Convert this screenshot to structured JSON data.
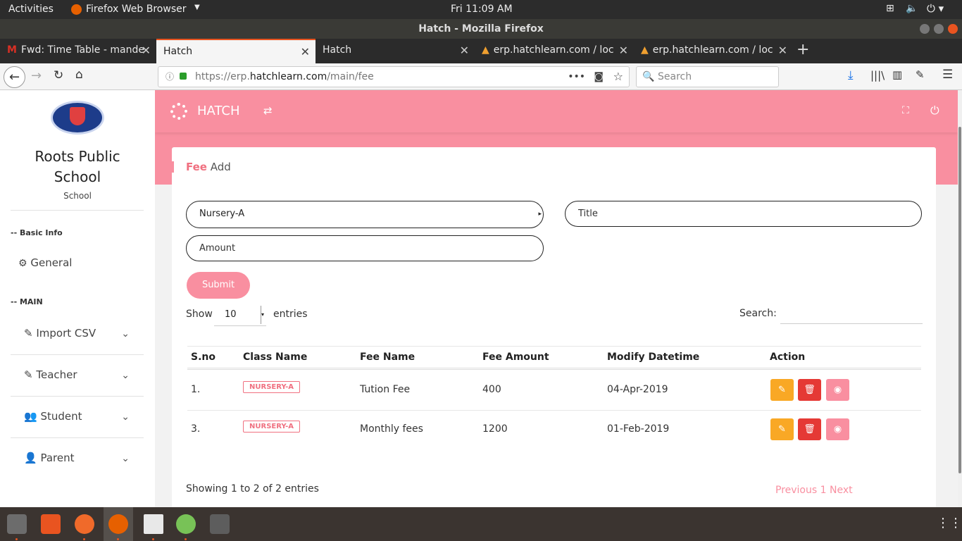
{
  "system": {
    "activities": "Activities",
    "app_menu": "Firefox Web Browser",
    "clock": "Fri 11:09 AM"
  },
  "window": {
    "title": "Hatch - Mozilla Firefox"
  },
  "tabs": [
    {
      "label": "Fwd: Time Table - mande"
    },
    {
      "label": "Hatch"
    },
    {
      "label": "Hatch"
    },
    {
      "label": "erp.hatchlearn.com / loc"
    },
    {
      "label": "erp.hatchlearn.com / loc"
    }
  ],
  "nav": {
    "url_prefix": "https://erp.",
    "url_domain": "hatchlearn.com",
    "url_path": "/main/fee",
    "search_placeholder": "Search"
  },
  "sidebar": {
    "school_name": "Roots Public School",
    "school_type": "School",
    "section_basic": "-- Basic Info",
    "general": "General",
    "section_main": "-- MAIN",
    "items": [
      {
        "label": "Import CSV"
      },
      {
        "label": "Teacher"
      },
      {
        "label": "Student"
      },
      {
        "label": "Parent"
      }
    ]
  },
  "header": {
    "brand": "HATCH"
  },
  "card": {
    "title_accent": "Fee",
    "title_rest": " Add"
  },
  "form": {
    "class_value": "Nursery-A",
    "title_placeholder": "Title",
    "amount_placeholder": "Amount",
    "submit": "Submit"
  },
  "table": {
    "show_label": "Show",
    "entries_value": "10",
    "entries_label": "entries",
    "search_label": "Search:",
    "headers": [
      "S.no",
      "Class Name",
      "Fee Name",
      "Fee Amount",
      "Modify Datetime",
      "Action"
    ],
    "rows": [
      {
        "sno": "1.",
        "class": "NURSERY-A",
        "fee_name": "Tution Fee",
        "amount": "400",
        "datetime": "04-Apr-2019"
      },
      {
        "sno": "3.",
        "class": "NURSERY-A",
        "fee_name": "Monthly fees",
        "amount": "1200",
        "datetime": "01-Feb-2019"
      }
    ],
    "info": "Showing 1 to 2 of 2 entries",
    "prev": "Previous",
    "page": "1",
    "next": "Next"
  },
  "colors": {
    "accent": "#f98fa0",
    "edit": "#f9a825",
    "delete": "#e53935",
    "view": "#f98fa0"
  }
}
